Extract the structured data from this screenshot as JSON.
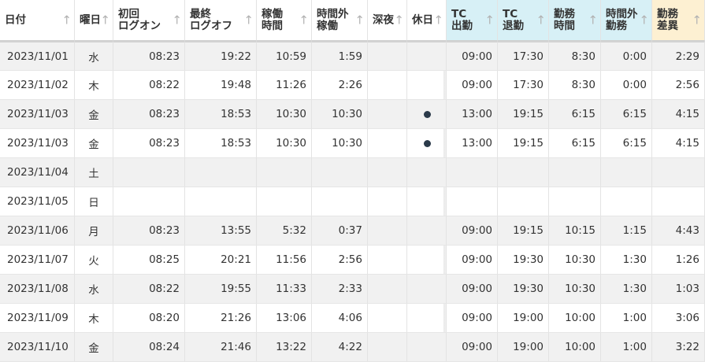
{
  "headers": {
    "date": "日付",
    "weekday": "曜日",
    "first_logon": "初回\nログオン",
    "last_logoff": "最終\nログオフ",
    "work_time": "稼働\n時間",
    "overtime_work": "時間外\n稼働",
    "late_night": "深夜",
    "holiday": "休日",
    "tc_in": "TC\n出勤",
    "tc_out": "TC\n退勤",
    "duty_time": "勤務\n時間",
    "overtime_duty": "時間外\n勤務",
    "duty_diff": "勤務\n差異"
  },
  "sort_icon": "↑",
  "colors": {
    "tc_header": "#d7f0f6",
    "diff_header": "#fdf0d2",
    "holiday_dot": "#2b3a4a"
  },
  "rows": [
    {
      "date": "2023/11/01",
      "weekday": "水",
      "first_logon": "08:23",
      "last_logoff": "19:22",
      "work_time": "10:59",
      "overtime_work": "1:59",
      "late_night": "",
      "holiday": false,
      "tc_in": "09:00",
      "tc_out": "17:30",
      "duty_time": "8:30",
      "overtime_duty": "0:00",
      "duty_diff": "2:29"
    },
    {
      "date": "2023/11/02",
      "weekday": "木",
      "first_logon": "08:22",
      "last_logoff": "19:48",
      "work_time": "11:26",
      "overtime_work": "2:26",
      "late_night": "",
      "holiday": false,
      "tc_in": "09:00",
      "tc_out": "17:30",
      "duty_time": "8:30",
      "overtime_duty": "0:00",
      "duty_diff": "2:56"
    },
    {
      "date": "2023/11/03",
      "weekday": "金",
      "first_logon": "08:23",
      "last_logoff": "18:53",
      "work_time": "10:30",
      "overtime_work": "10:30",
      "late_night": "",
      "holiday": true,
      "tc_in": "13:00",
      "tc_out": "19:15",
      "duty_time": "6:15",
      "overtime_duty": "6:15",
      "duty_diff": "4:15"
    },
    {
      "date": "2023/11/03",
      "weekday": "金",
      "first_logon": "08:23",
      "last_logoff": "18:53",
      "work_time": "10:30",
      "overtime_work": "10:30",
      "late_night": "",
      "holiday": true,
      "tc_in": "13:00",
      "tc_out": "19:15",
      "duty_time": "6:15",
      "overtime_duty": "6:15",
      "duty_diff": "4:15"
    },
    {
      "date": "2023/11/04",
      "weekday": "土",
      "first_logon": "",
      "last_logoff": "",
      "work_time": "",
      "overtime_work": "",
      "late_night": "",
      "holiday": false,
      "tc_in": "",
      "tc_out": "",
      "duty_time": "",
      "overtime_duty": "",
      "duty_diff": ""
    },
    {
      "date": "2023/11/05",
      "weekday": "日",
      "first_logon": "",
      "last_logoff": "",
      "work_time": "",
      "overtime_work": "",
      "late_night": "",
      "holiday": false,
      "tc_in": "",
      "tc_out": "",
      "duty_time": "",
      "overtime_duty": "",
      "duty_diff": ""
    },
    {
      "date": "2023/11/06",
      "weekday": "月",
      "first_logon": "08:23",
      "last_logoff": "13:55",
      "work_time": "5:32",
      "overtime_work": "0:37",
      "late_night": "",
      "holiday": false,
      "tc_in": "09:00",
      "tc_out": "19:15",
      "duty_time": "10:15",
      "overtime_duty": "1:15",
      "duty_diff": "4:43"
    },
    {
      "date": "2023/11/07",
      "weekday": "火",
      "first_logon": "08:25",
      "last_logoff": "20:21",
      "work_time": "11:56",
      "overtime_work": "2:56",
      "late_night": "",
      "holiday": false,
      "tc_in": "09:00",
      "tc_out": "19:30",
      "duty_time": "10:30",
      "overtime_duty": "1:30",
      "duty_diff": "1:26"
    },
    {
      "date": "2023/11/08",
      "weekday": "水",
      "first_logon": "08:22",
      "last_logoff": "19:55",
      "work_time": "11:33",
      "overtime_work": "2:33",
      "late_night": "",
      "holiday": false,
      "tc_in": "09:00",
      "tc_out": "19:30",
      "duty_time": "10:30",
      "overtime_duty": "1:30",
      "duty_diff": "1:03"
    },
    {
      "date": "2023/11/09",
      "weekday": "木",
      "first_logon": "08:20",
      "last_logoff": "21:26",
      "work_time": "13:06",
      "overtime_work": "4:06",
      "late_night": "",
      "holiday": false,
      "tc_in": "09:00",
      "tc_out": "19:00",
      "duty_time": "10:00",
      "overtime_duty": "1:00",
      "duty_diff": "3:06"
    },
    {
      "date": "2023/11/10",
      "weekday": "金",
      "first_logon": "08:24",
      "last_logoff": "21:46",
      "work_time": "13:22",
      "overtime_work": "4:22",
      "late_night": "",
      "holiday": false,
      "tc_in": "09:00",
      "tc_out": "19:00",
      "duty_time": "10:00",
      "overtime_duty": "1:00",
      "duty_diff": "3:22"
    }
  ]
}
